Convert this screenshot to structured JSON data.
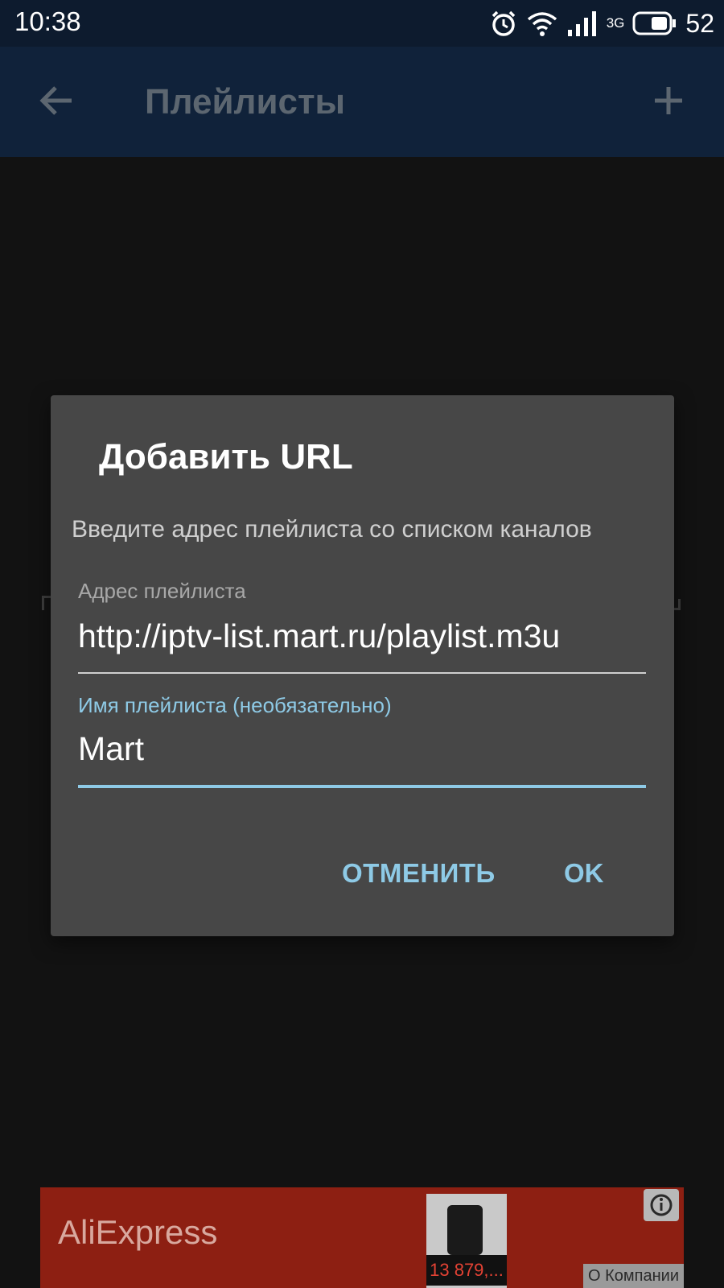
{
  "status_bar": {
    "time": "10:38",
    "network_type": "3G",
    "battery_level": "52",
    "icons": [
      "alarm-icon",
      "wifi-icon",
      "signal-icon",
      "battery-icon"
    ]
  },
  "app_bar": {
    "title": "Плейлисты",
    "back_icon": "arrow-left-icon",
    "add_icon": "plus-icon"
  },
  "dialog": {
    "title": "Добавить URL",
    "message": "Введите адрес плейлиста со списком каналов",
    "url_field": {
      "label": "Адрес плейлиста",
      "value": "http://iptv-list.mart.ru/playlist.m3u"
    },
    "name_field": {
      "label": "Имя плейлиста (необязательно)",
      "value": "Mart"
    },
    "cancel_label": "ОТМЕНИТЬ",
    "ok_label": "OK"
  },
  "ad": {
    "brand": "AliExpress",
    "price": "13 879,...",
    "company_link": "О Компании",
    "info_icon": "info-icon"
  },
  "colors": {
    "accent": "#8ecae6",
    "dialog_bg": "#474747",
    "app_bar_bg": "#10223a",
    "status_bar_bg": "#0d1b2e",
    "ad_bg": "#8d1f12"
  }
}
